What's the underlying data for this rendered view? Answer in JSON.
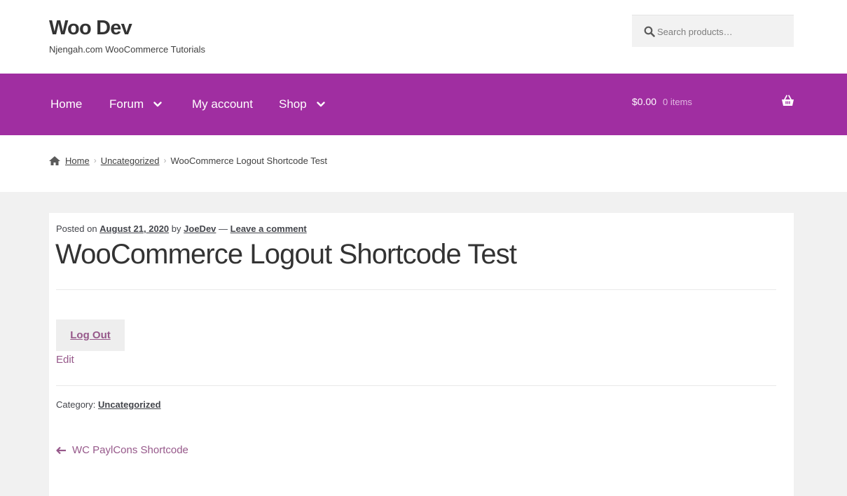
{
  "header": {
    "site_title": "Woo Dev",
    "tagline": "Njengah.com WooCommerce Tutorials",
    "search_placeholder": "Search products…"
  },
  "nav": {
    "items": [
      {
        "label": "Home",
        "has_dropdown": false
      },
      {
        "label": "Forum",
        "has_dropdown": true
      },
      {
        "label": "My account",
        "has_dropdown": false
      },
      {
        "label": "Shop",
        "has_dropdown": true
      }
    ],
    "cart": {
      "amount": "$0.00",
      "count": "0 items"
    }
  },
  "breadcrumb": {
    "home": "Home",
    "category": "Uncategorized",
    "current": "WooCommerce Logout Shortcode Test"
  },
  "post": {
    "posted_on_label": "Posted on",
    "date": "August 21, 2020",
    "by_label": "by",
    "author": "JoeDev",
    "dash": "—",
    "comment_link": "Leave a comment",
    "title": "WooCommerce Logout Shortcode Test",
    "logout_label": "Log Out",
    "edit_label": "Edit",
    "category_label": "Category:",
    "category": "Uncategorized",
    "prev_post": "WC PaylCons Shortcode"
  },
  "colors": {
    "nav_bg": "#a02ea1",
    "link": "#96588a",
    "content_bg": "#f1f1f1"
  }
}
